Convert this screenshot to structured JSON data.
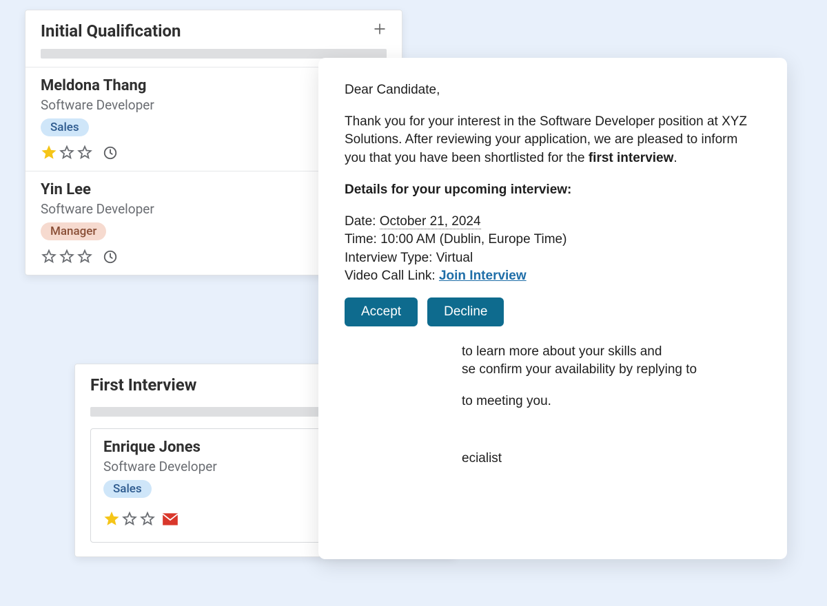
{
  "columns": {
    "initial": {
      "title": "Initial Qualification",
      "cards": [
        {
          "name": "Meldona Thang",
          "role": "Software Developer",
          "tag": "Sales",
          "stars": 1
        },
        {
          "name": "Yin Lee",
          "role": "Software Developer",
          "tag": "Manager",
          "stars": 0
        }
      ]
    },
    "first_interview": {
      "title": "First Interview",
      "count": "1",
      "cards": [
        {
          "name": "Enrique Jones",
          "role": "Software Developer",
          "tag": "Sales",
          "stars": 1,
          "attachments": "0"
        }
      ]
    }
  },
  "email": {
    "greeting": "Dear Candidate,",
    "intro_part1": "Thank you for your interest in the Software Developer position at XYZ Solutions. After reviewing your application, we are pleased to inform you that you have been shortlisted for the ",
    "intro_bold": "first interview",
    "intro_end": ".",
    "details_heading": "Details for your upcoming interview:",
    "date_label": "Date: ",
    "date_value": "October 21, 2024",
    "time_line": "Time: 10:00 AM (Dublin, Europe Time)",
    "type_line": "Interview Type: Virtual",
    "link_label": "Video Call Link: ",
    "link_text": "Join Interview",
    "accept": "Accept",
    "decline": "Decline",
    "para_skills": "to learn more about your skills and",
    "para_confirm": "se confirm your availability by replying to",
    "para_meeting": "to meeting you.",
    "signature_role": "ecialist"
  }
}
